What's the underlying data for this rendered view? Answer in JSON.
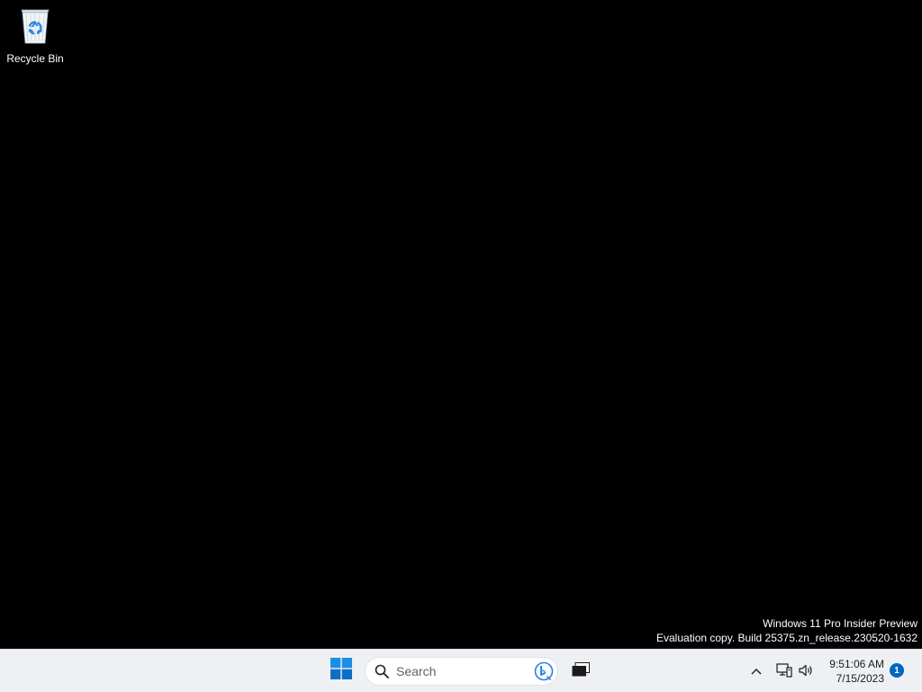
{
  "desktop": {
    "icons": [
      {
        "label": "Recycle Bin",
        "icon": "recycle-bin-icon"
      }
    ],
    "watermark": {
      "line1": "Windows 11 Pro Insider Preview",
      "line2": "Evaluation copy. Build 25375.zn_release.230520-1632"
    },
    "background_color": "#000000"
  },
  "taskbar": {
    "background_color": "#eef0f3",
    "start_icon": "windows-logo-icon",
    "search": {
      "placeholder": "Search",
      "icon": "search-icon",
      "bing_icon": "bing-chat-icon"
    },
    "task_view_icon": "task-view-icon",
    "tray": {
      "overflow_icon": "chevron-up-icon",
      "network_icon": "network-icon",
      "volume_icon": "volume-icon",
      "time": "9:51:06 AM",
      "date": "7/15/2023",
      "notification_count": "1",
      "accent_color": "#0067c0"
    }
  }
}
